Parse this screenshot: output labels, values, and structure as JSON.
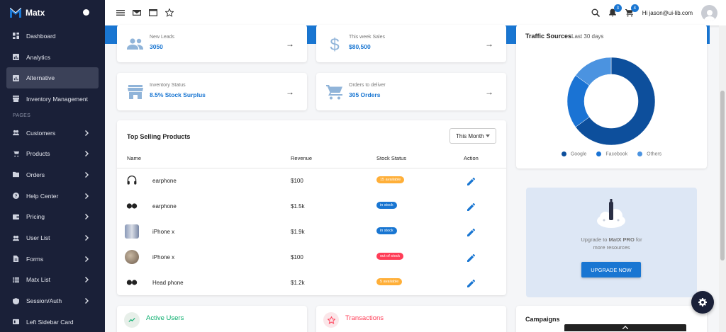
{
  "sidebar": {
    "brand": "Matx",
    "items": [
      {
        "label": "Dashboard",
        "icon": "dashboard-icon"
      },
      {
        "label": "Analytics",
        "icon": "analytics-icon"
      },
      {
        "label": "Alternative",
        "icon": "analytics-icon"
      },
      {
        "label": "Inventory Management",
        "icon": "store-icon"
      }
    ],
    "section": "PAGES",
    "pages": [
      {
        "label": "Customers",
        "icon": "people-icon"
      },
      {
        "label": "Products",
        "icon": "cart-icon"
      },
      {
        "label": "Orders",
        "icon": "folder-icon"
      },
      {
        "label": "Help Center",
        "icon": "help-icon"
      },
      {
        "label": "Pricing",
        "icon": "wallet-icon"
      },
      {
        "label": "User List",
        "icon": "people-icon"
      },
      {
        "label": "Forms",
        "icon": "description-icon"
      },
      {
        "label": "Matx List",
        "icon": "list-icon"
      },
      {
        "label": "Session/Auth",
        "icon": "security-icon"
      },
      {
        "label": "Left Sidebar Card",
        "icon": "view-icon"
      }
    ]
  },
  "topbar": {
    "greeting": "Hi jason@ui-lib.com",
    "notifications_count": "3",
    "cart_count": "4"
  },
  "stats": [
    {
      "label": "New Leads",
      "value": "3050"
    },
    {
      "label": "This week Sales",
      "value": "$80,500"
    },
    {
      "label": "Inventory Status",
      "value": "8.5% Stock Surplus"
    },
    {
      "label": "Orders to deliver",
      "value": "305 Orders"
    }
  ],
  "arrow": "→",
  "top_selling": {
    "title": "Top Selling Products",
    "filter": "This Month",
    "columns": [
      "Name",
      "Revenue",
      "Stock Status",
      "Action"
    ],
    "rows": [
      {
        "name": "earphone",
        "revenue": "$100",
        "status": "15 available",
        "status_color": "#ffaf38"
      },
      {
        "name": "earphone",
        "revenue": "$1.5k",
        "status": "in stock",
        "status_color": "#1976d2"
      },
      {
        "name": "iPhone x",
        "revenue": "$1.9k",
        "status": "in stock",
        "status_color": "#1976d2"
      },
      {
        "name": "iPhone x",
        "revenue": "$100",
        "status": "out of stock",
        "status_color": "#ff3d57"
      },
      {
        "name": "Head phone",
        "revenue": "$1.2k",
        "status": "5 available",
        "status_color": "#ffaf38"
      }
    ]
  },
  "traffic": {
    "title": "Traffic Sources",
    "subtitle": "Last 30 days",
    "legend": [
      {
        "name": "Google",
        "color": "#0d4f9c"
      },
      {
        "name": "Facebook",
        "color": "#1a73d4"
      },
      {
        "name": "Others",
        "color": "#4b93e0"
      }
    ]
  },
  "chart_data": {
    "type": "pie",
    "title": "Traffic Sources",
    "subtitle": "Last 30 days",
    "categories": [
      "Google",
      "Facebook",
      "Others"
    ],
    "values": [
      65,
      20,
      15
    ],
    "colors": [
      "#0d4f9c",
      "#1a73d4",
      "#4b93e0"
    ],
    "legend_position": "bottom"
  },
  "upgrade": {
    "line1_prefix": "Upgrade to ",
    "brand": "MatX PRO",
    "line1_suffix": " for",
    "line2": "more resources",
    "button": "UPGRADE NOW"
  },
  "bottom": {
    "active_users": "Active Users",
    "transactions": "Transactions",
    "campaigns": "Campaigns"
  },
  "colors": {
    "primary": "#1976d2",
    "sidebar": "#1a2038",
    "green": "#08ad6c",
    "red": "#ff3d57"
  }
}
